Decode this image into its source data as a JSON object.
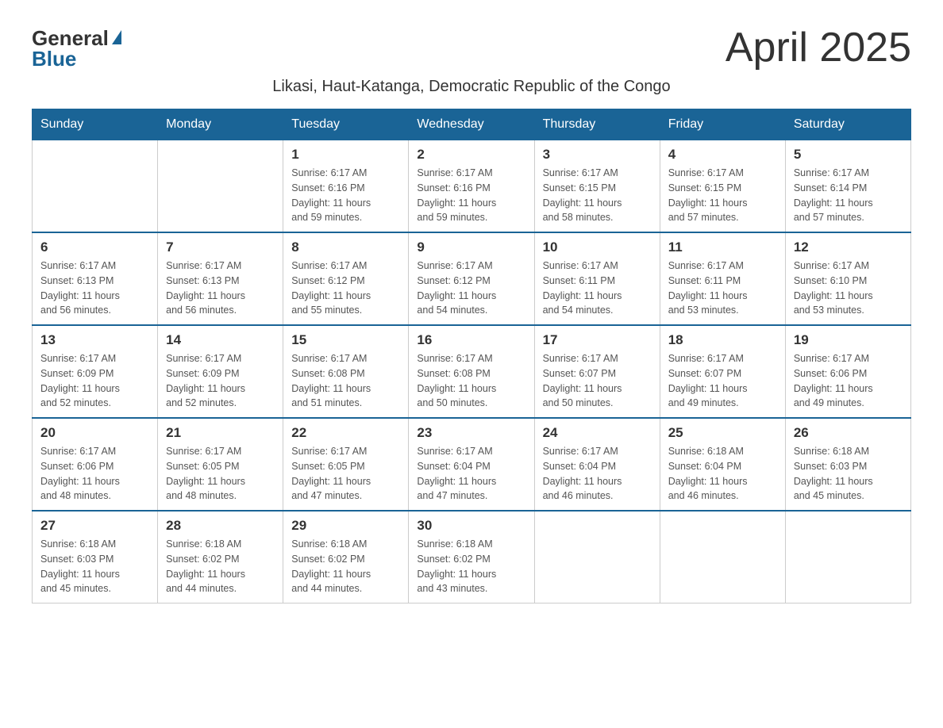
{
  "logo": {
    "general": "General",
    "blue": "Blue"
  },
  "title": "April 2025",
  "subtitle": "Likasi, Haut-Katanga, Democratic Republic of the Congo",
  "days_of_week": [
    "Sunday",
    "Monday",
    "Tuesday",
    "Wednesday",
    "Thursday",
    "Friday",
    "Saturday"
  ],
  "weeks": [
    [
      {
        "day": "",
        "info": ""
      },
      {
        "day": "",
        "info": ""
      },
      {
        "day": "1",
        "info": "Sunrise: 6:17 AM\nSunset: 6:16 PM\nDaylight: 11 hours\nand 59 minutes."
      },
      {
        "day": "2",
        "info": "Sunrise: 6:17 AM\nSunset: 6:16 PM\nDaylight: 11 hours\nand 59 minutes."
      },
      {
        "day": "3",
        "info": "Sunrise: 6:17 AM\nSunset: 6:15 PM\nDaylight: 11 hours\nand 58 minutes."
      },
      {
        "day": "4",
        "info": "Sunrise: 6:17 AM\nSunset: 6:15 PM\nDaylight: 11 hours\nand 57 minutes."
      },
      {
        "day": "5",
        "info": "Sunrise: 6:17 AM\nSunset: 6:14 PM\nDaylight: 11 hours\nand 57 minutes."
      }
    ],
    [
      {
        "day": "6",
        "info": "Sunrise: 6:17 AM\nSunset: 6:13 PM\nDaylight: 11 hours\nand 56 minutes."
      },
      {
        "day": "7",
        "info": "Sunrise: 6:17 AM\nSunset: 6:13 PM\nDaylight: 11 hours\nand 56 minutes."
      },
      {
        "day": "8",
        "info": "Sunrise: 6:17 AM\nSunset: 6:12 PM\nDaylight: 11 hours\nand 55 minutes."
      },
      {
        "day": "9",
        "info": "Sunrise: 6:17 AM\nSunset: 6:12 PM\nDaylight: 11 hours\nand 54 minutes."
      },
      {
        "day": "10",
        "info": "Sunrise: 6:17 AM\nSunset: 6:11 PM\nDaylight: 11 hours\nand 54 minutes."
      },
      {
        "day": "11",
        "info": "Sunrise: 6:17 AM\nSunset: 6:11 PM\nDaylight: 11 hours\nand 53 minutes."
      },
      {
        "day": "12",
        "info": "Sunrise: 6:17 AM\nSunset: 6:10 PM\nDaylight: 11 hours\nand 53 minutes."
      }
    ],
    [
      {
        "day": "13",
        "info": "Sunrise: 6:17 AM\nSunset: 6:09 PM\nDaylight: 11 hours\nand 52 minutes."
      },
      {
        "day": "14",
        "info": "Sunrise: 6:17 AM\nSunset: 6:09 PM\nDaylight: 11 hours\nand 52 minutes."
      },
      {
        "day": "15",
        "info": "Sunrise: 6:17 AM\nSunset: 6:08 PM\nDaylight: 11 hours\nand 51 minutes."
      },
      {
        "day": "16",
        "info": "Sunrise: 6:17 AM\nSunset: 6:08 PM\nDaylight: 11 hours\nand 50 minutes."
      },
      {
        "day": "17",
        "info": "Sunrise: 6:17 AM\nSunset: 6:07 PM\nDaylight: 11 hours\nand 50 minutes."
      },
      {
        "day": "18",
        "info": "Sunrise: 6:17 AM\nSunset: 6:07 PM\nDaylight: 11 hours\nand 49 minutes."
      },
      {
        "day": "19",
        "info": "Sunrise: 6:17 AM\nSunset: 6:06 PM\nDaylight: 11 hours\nand 49 minutes."
      }
    ],
    [
      {
        "day": "20",
        "info": "Sunrise: 6:17 AM\nSunset: 6:06 PM\nDaylight: 11 hours\nand 48 minutes."
      },
      {
        "day": "21",
        "info": "Sunrise: 6:17 AM\nSunset: 6:05 PM\nDaylight: 11 hours\nand 48 minutes."
      },
      {
        "day": "22",
        "info": "Sunrise: 6:17 AM\nSunset: 6:05 PM\nDaylight: 11 hours\nand 47 minutes."
      },
      {
        "day": "23",
        "info": "Sunrise: 6:17 AM\nSunset: 6:04 PM\nDaylight: 11 hours\nand 47 minutes."
      },
      {
        "day": "24",
        "info": "Sunrise: 6:17 AM\nSunset: 6:04 PM\nDaylight: 11 hours\nand 46 minutes."
      },
      {
        "day": "25",
        "info": "Sunrise: 6:18 AM\nSunset: 6:04 PM\nDaylight: 11 hours\nand 46 minutes."
      },
      {
        "day": "26",
        "info": "Sunrise: 6:18 AM\nSunset: 6:03 PM\nDaylight: 11 hours\nand 45 minutes."
      }
    ],
    [
      {
        "day": "27",
        "info": "Sunrise: 6:18 AM\nSunset: 6:03 PM\nDaylight: 11 hours\nand 45 minutes."
      },
      {
        "day": "28",
        "info": "Sunrise: 6:18 AM\nSunset: 6:02 PM\nDaylight: 11 hours\nand 44 minutes."
      },
      {
        "day": "29",
        "info": "Sunrise: 6:18 AM\nSunset: 6:02 PM\nDaylight: 11 hours\nand 44 minutes."
      },
      {
        "day": "30",
        "info": "Sunrise: 6:18 AM\nSunset: 6:02 PM\nDaylight: 11 hours\nand 43 minutes."
      },
      {
        "day": "",
        "info": ""
      },
      {
        "day": "",
        "info": ""
      },
      {
        "day": "",
        "info": ""
      }
    ]
  ]
}
